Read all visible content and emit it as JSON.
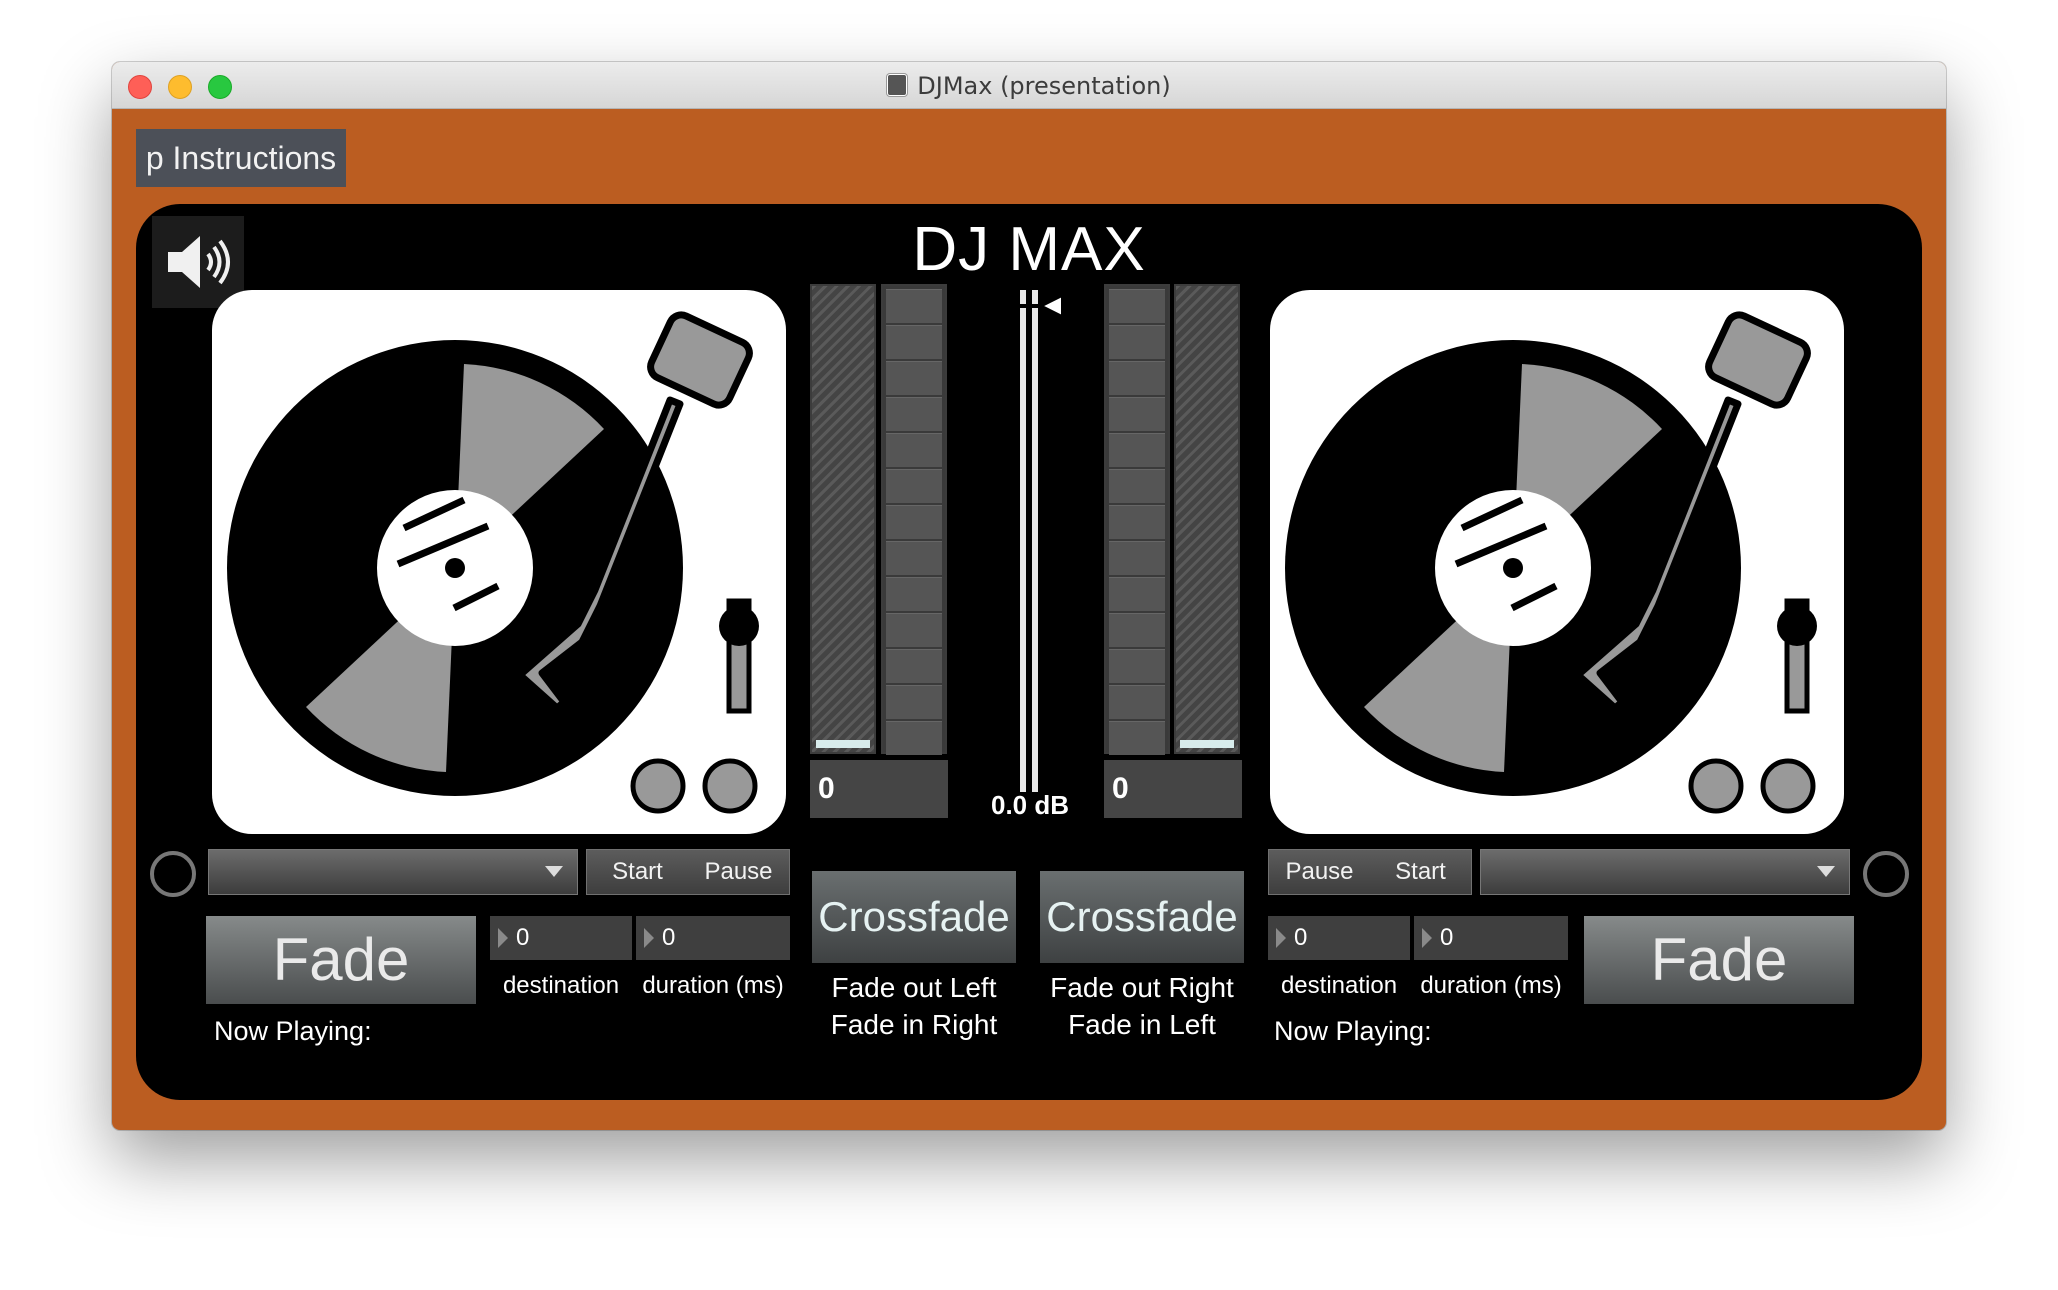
{
  "window": {
    "title": "DJMax (presentation)"
  },
  "instructions_button": "p Instructions",
  "panel": {
    "title": "DJ MAX"
  },
  "left_deck": {
    "meter_value": "0",
    "start_label": "Start",
    "pause_label": "Pause",
    "track_selected": "",
    "fade_label": "Fade",
    "destination_value": "0",
    "duration_value": "0",
    "destination_label": "destination",
    "duration_label": "duration (ms)",
    "now_playing_label": "Now Playing:"
  },
  "right_deck": {
    "meter_value": "0",
    "start_label": "Start",
    "pause_label": "Pause",
    "track_selected": "",
    "fade_label": "Fade",
    "destination_value": "0",
    "duration_value": "0",
    "destination_label": "destination",
    "duration_label": "duration (ms)",
    "now_playing_label": "Now Playing:"
  },
  "master_gain": {
    "readout": "0.0 dB"
  },
  "crossfade_left": {
    "label": "Crossfade",
    "caption_line1": "Fade out Left",
    "caption_line2": "Fade in Right"
  },
  "crossfade_right": {
    "label": "Crossfade",
    "caption_line1": "Fade out Right",
    "caption_line2": "Fade in Left"
  },
  "colors": {
    "window_background": "#bb5d21",
    "panel_background": "#000000",
    "button_dark": "#4c5058",
    "meter_base": "#d8ecec",
    "platter_gray": "#999999"
  },
  "icons": {
    "speaker": "speaker-volume-icon",
    "dropdown": "chevron-down-icon",
    "numbox_arrow": "triangle-right-icon"
  }
}
